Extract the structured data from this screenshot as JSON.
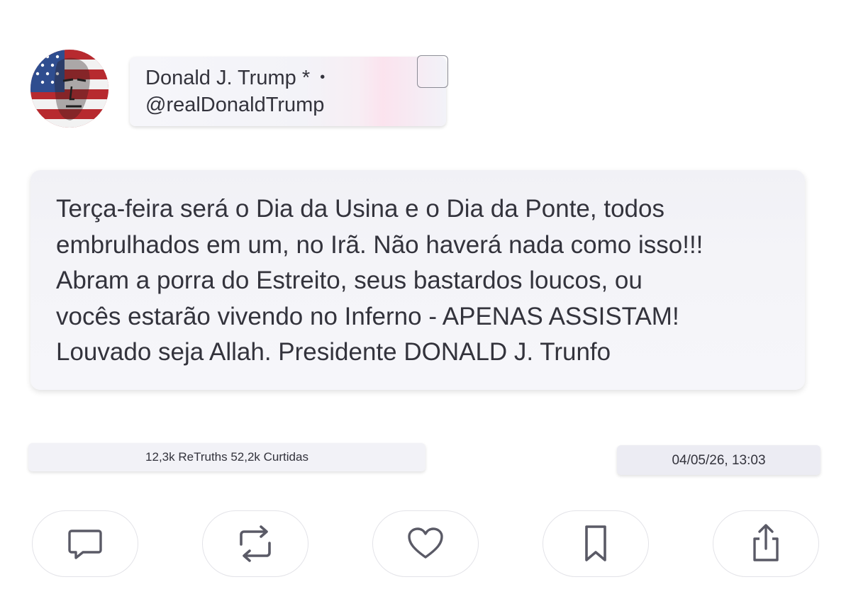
{
  "profile": {
    "display_name": "Donald J. Trump",
    "verified_mark": "*",
    "separator": "•",
    "handle": "@realDonaldTrump",
    "avatar_icon": "flag-portrait-avatar"
  },
  "post": {
    "lines": [
      "Terça-feira será o Dia da Usina e o Dia da Ponte, todos",
      "embrulhados em um, no Irã. Não haverá nada como isso!!!",
      "Abram a porra do Estreito, seus bastardos loucos, ou",
      "vocês estarão vivendo no Inferno - APENAS ASSISTAM!",
      "Louvado seja Allah. Presidente DONALD J. Trunfo"
    ]
  },
  "stats": {
    "text": "12,3k ReTruths 52,2k Curtidas"
  },
  "timestamp": "04/05/26, 13:03",
  "actions": [
    {
      "name": "reply",
      "icon": "comment-icon"
    },
    {
      "name": "retruth",
      "icon": "repost-icon"
    },
    {
      "name": "like",
      "icon": "heart-icon"
    },
    {
      "name": "bookmark",
      "icon": "bookmark-icon"
    },
    {
      "name": "share",
      "icon": "share-icon"
    }
  ],
  "colors": {
    "text": "#33333c",
    "icon": "#5a5a66",
    "card_bg": "#f3f3f8",
    "avatar_red": "#b72a2f",
    "avatar_blue": "#2f4d8f"
  }
}
